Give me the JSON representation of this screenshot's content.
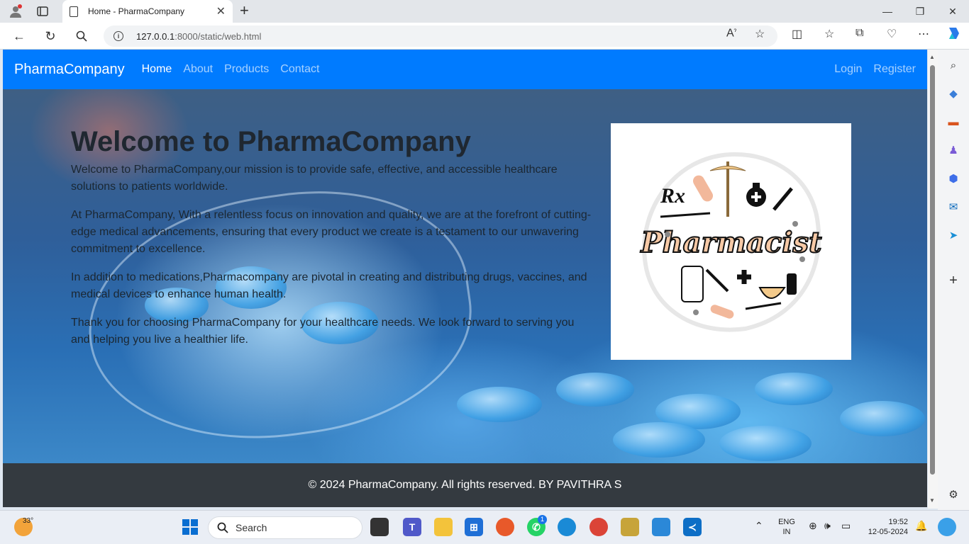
{
  "browser": {
    "tab_title": "Home - PharmaCompany",
    "url_host": "127.0.0.1",
    "url_rest": ":8000/static/web.html"
  },
  "navbar": {
    "brand": "PharmaCompany",
    "links": [
      "Home",
      "About",
      "Products",
      "Contact"
    ],
    "right_links": [
      "Login",
      "Register"
    ]
  },
  "hero": {
    "heading": "Welcome to PharmaCompany",
    "paragraphs": [
      "Welcome to PharmaCompany,our mission is to provide safe, effective, and accessible healthcare solutions to patients worldwide.",
      "At PharmaCompany, With a relentless focus on innovation and quality, we are at the forefront of cutting-edge medical advancements, ensuring that every product we create is a testament to our unwavering commitment to excellence.",
      "In addition to medications,Pharmacompany are pivotal in creating and distributing drugs, vaccines, and medical devices to enhance human health.",
      "Thank you for choosing PharmaCompany for your healthcare needs. We look forward to serving you and helping you live a healthier life."
    ],
    "image_text": "Pharmacist",
    "image_rx": "Rx"
  },
  "footer": {
    "text": "© 2024 PharmaCompany. All rights reserved. BY PAVITHRA S"
  },
  "taskbar": {
    "weather": "33°",
    "search_placeholder": "Search",
    "teams_badge": "1",
    "lang_top": "ENG",
    "lang_bottom": "IN",
    "time": "19:52",
    "date": "12-05-2024"
  },
  "colors": {
    "navbar": "#007bff",
    "footer": "#343a40"
  }
}
